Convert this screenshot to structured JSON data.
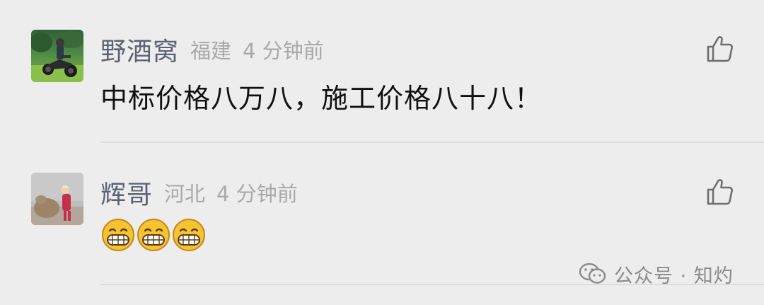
{
  "comments": [
    {
      "nickname": "野酒窝",
      "location": "福建",
      "time": "4 分钟前",
      "content": "中标价格八万八，施工价格八十八！",
      "avatar": "motorcycle-rider-photo"
    },
    {
      "nickname": "辉哥",
      "location": "河北",
      "time": "4 分钟前",
      "content_emoji": [
        "grin-emoji",
        "grin-emoji",
        "grin-emoji"
      ],
      "avatar": "person-with-camel-photo"
    }
  ],
  "watermark": {
    "text": "公众号 · 知灼",
    "icon": "wechat-icon"
  },
  "colors": {
    "background": "#ededed",
    "nickname": "#5b6273",
    "meta": "#a9a9a9",
    "content": "#111111",
    "divider": "#dcdcdc"
  }
}
